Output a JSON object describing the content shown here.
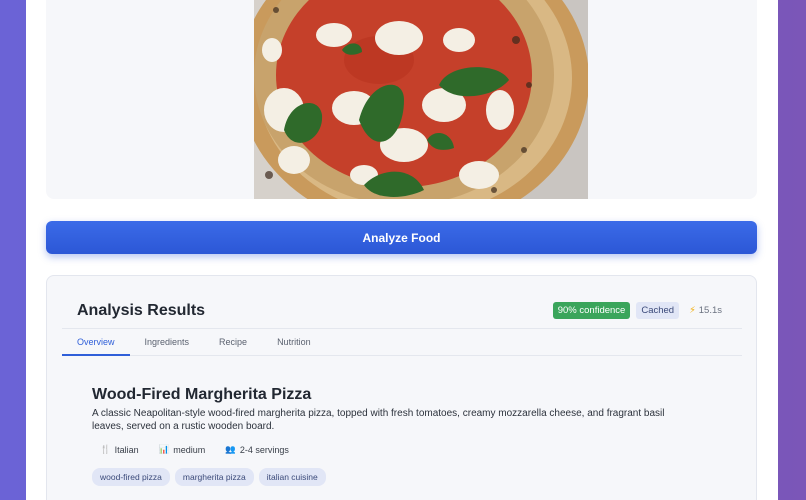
{
  "action": {
    "analyze_label": "Analyze Food"
  },
  "results": {
    "title": "Analysis Results",
    "confidence_badge": "90% confidence",
    "cached_badge": "Cached",
    "timing": "15.1s",
    "tabs": [
      {
        "label": "Overview",
        "active": true
      },
      {
        "label": "Ingredients",
        "active": false
      },
      {
        "label": "Recipe",
        "active": false
      },
      {
        "label": "Nutrition",
        "active": false
      }
    ],
    "dish": {
      "name": "Wood-Fired Margherita Pizza",
      "description": "A classic Neapolitan-style wood-fired margherita pizza, topped with fresh tomatoes, creamy mozzarella cheese, and fragrant basil leaves, served on a rustic wooden board.",
      "cuisine": "Italian",
      "difficulty": "medium",
      "servings": "2-4 servings"
    },
    "tags": [
      "wood-fired pizza",
      "margherita pizza",
      "italian cuisine"
    ]
  },
  "icons": {
    "cuisine": "utensils-icon",
    "difficulty": "bar-chart-icon",
    "servings": "people-icon",
    "timing": "lightning-bolt-icon"
  },
  "colors": {
    "accent": "#2f5fd9",
    "confidence": "#3aa55b",
    "background_gradient_start": "#6b63d6",
    "background_gradient_end": "#7b56b8"
  }
}
